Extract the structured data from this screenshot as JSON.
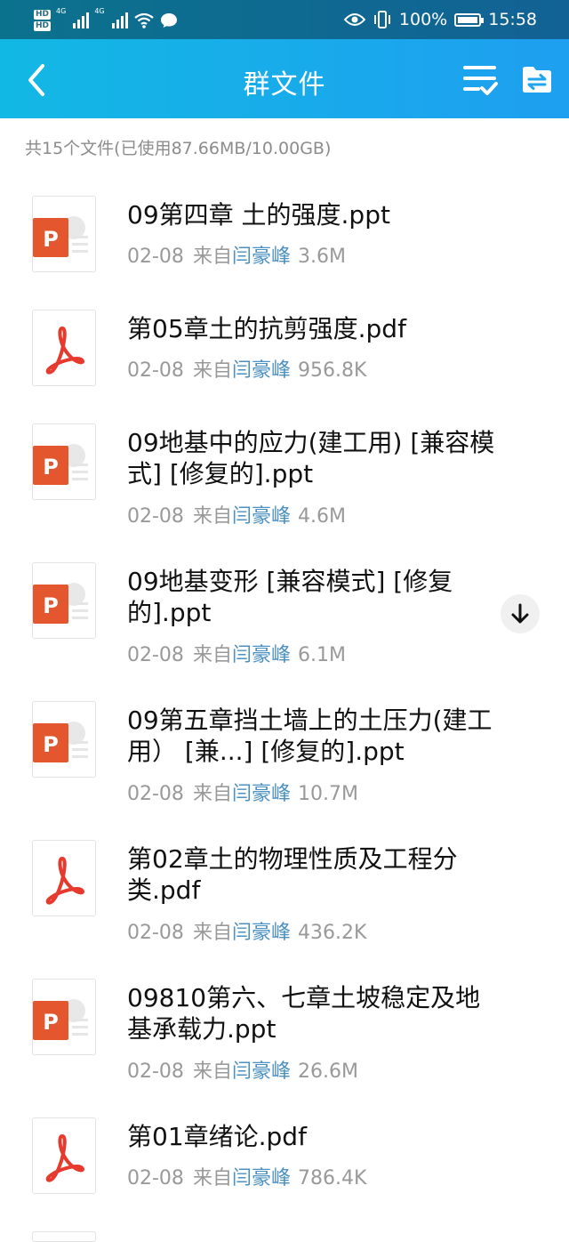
{
  "status": {
    "network_a": "4G",
    "network_b": "4G",
    "battery": "100%",
    "time": "15:58"
  },
  "header": {
    "title": "群文件"
  },
  "summary": "共15个文件(已使用87.66MB/10.00GB)",
  "files": [
    {
      "type": "ppt",
      "name": "09第四章 土的强度.ppt",
      "date": "02-08",
      "from": "来自",
      "sender": "闫豪峰",
      "size": "3.6M"
    },
    {
      "type": "pdf",
      "name": "第05章土的抗剪强度.pdf",
      "date": "02-08",
      "from": "来自",
      "sender": "闫豪峰",
      "size": "956.8K"
    },
    {
      "type": "ppt",
      "name": "09地基中的应力(建工用) [兼容模式] [修复的].ppt",
      "date": "02-08",
      "from": "来自",
      "sender": "闫豪峰",
      "size": "4.6M"
    },
    {
      "type": "ppt",
      "name": "09地基变形 [兼容模式] [修复的].ppt",
      "date": "02-08",
      "from": "来自",
      "sender": "闫豪峰",
      "size": "6.1M"
    },
    {
      "type": "ppt",
      "name": "09第五章挡土墙上的土压力(建工用） [兼...] [修复的].ppt",
      "date": "02-08",
      "from": "来自",
      "sender": "闫豪峰",
      "size": "10.7M"
    },
    {
      "type": "pdf",
      "name": "第02章土的物理性质及工程分类.pdf",
      "date": "02-08",
      "from": "来自",
      "sender": "闫豪峰",
      "size": "436.2K"
    },
    {
      "type": "ppt",
      "name": "09810第六、七章土坡稳定及地基承载力.ppt",
      "date": "02-08",
      "from": "来自",
      "sender": "闫豪峰",
      "size": "26.6M"
    },
    {
      "type": "pdf",
      "name": "第01章绪论.pdf",
      "date": "02-08",
      "from": "来自",
      "sender": "闫豪峰",
      "size": "786.4K"
    }
  ],
  "colors": {
    "header_start": "#12b8e4",
    "header_end": "#1e9ff0",
    "ppt": "#e4572e",
    "pdf": "#e63a2e",
    "link": "#4a90c2"
  },
  "icons": {
    "back": "chevron-left-icon",
    "sort": "list-check-icon",
    "transfer": "folder-transfer-icon",
    "scroll": "arrow-down-icon"
  }
}
